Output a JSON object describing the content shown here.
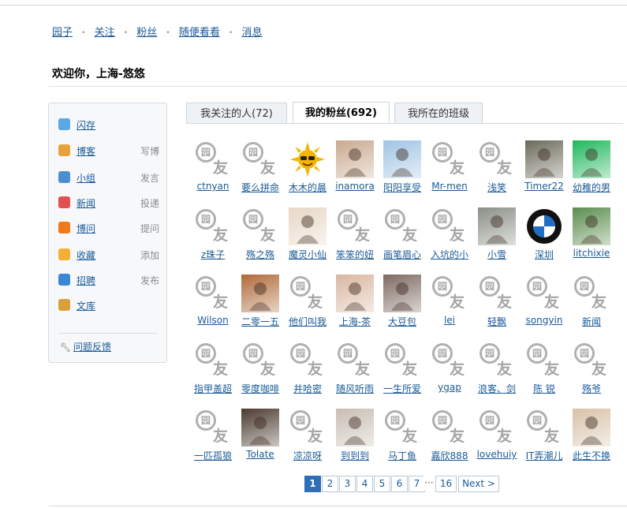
{
  "nav": {
    "items": [
      "园子",
      "关注",
      "粉丝",
      "随便看看",
      "消息"
    ],
    "separator": "•"
  },
  "welcome": "欢迎你，上海-悠悠",
  "sidebar": {
    "items": [
      {
        "label": "闪存",
        "action": "",
        "icon": "speech-bubble-icon",
        "color": "#5aa9e6"
      },
      {
        "label": "博客",
        "action": "写博",
        "icon": "notepad-pencil-icon",
        "color": "#e8a23a"
      },
      {
        "label": "小组",
        "action": "发言",
        "icon": "group-icon",
        "color": "#4a8fd4"
      },
      {
        "label": "新闻",
        "action": "投递",
        "icon": "news-icon",
        "color": "#e05050"
      },
      {
        "label": "博问",
        "action": "提问",
        "icon": "question-icon",
        "color": "#f07a1a"
      },
      {
        "label": "收藏",
        "action": "添加",
        "icon": "folder-icon",
        "color": "#f2b035"
      },
      {
        "label": "招聘",
        "action": "发布",
        "icon": "person-icon",
        "color": "#3b86d6"
      },
      {
        "label": "文库",
        "action": "",
        "icon": "book-icon",
        "color": "#d8a03a"
      }
    ],
    "feedback": "问题反馈",
    "feedback_icon": "wrench-icon"
  },
  "tabs": [
    {
      "label": "我关注的人(72)",
      "active": false
    },
    {
      "label": "我的粉丝(692)",
      "active": true
    },
    {
      "label": "我所在的班级",
      "active": false
    }
  ],
  "default_avatar": {
    "top": "园",
    "bottom": "友"
  },
  "users": [
    {
      "name": "ctnyan",
      "avatar": "default"
    },
    {
      "name": "要么拼命",
      "avatar": "default"
    },
    {
      "name": "木木的晨",
      "avatar": "sun",
      "color": "#f4b400"
    },
    {
      "name": "inamora",
      "avatar": "photo",
      "color": "#c9a98e"
    },
    {
      "name": "阳阳享受",
      "avatar": "photo",
      "color": "#9fc4e3"
    },
    {
      "name": "Mr-men",
      "avatar": "default"
    },
    {
      "name": "浅笑",
      "avatar": "default"
    },
    {
      "name": "Timer22",
      "avatar": "photo",
      "color": "#6a6a5a"
    },
    {
      "name": "幼稚的男",
      "avatar": "photo",
      "color": "#1fb85c"
    },
    {
      "name": "z珠子",
      "avatar": "default"
    },
    {
      "name": "殇之殇",
      "avatar": "default"
    },
    {
      "name": "魔灵小仙",
      "avatar": "photo",
      "color": "#e8d7c5"
    },
    {
      "name": "笨笨的妞",
      "avatar": "default"
    },
    {
      "name": "画笔眉心",
      "avatar": "default"
    },
    {
      "name": "入坑的小",
      "avatar": "default"
    },
    {
      "name": "小雪",
      "avatar": "photo",
      "color": "#8a8f86"
    },
    {
      "name": "深圳",
      "avatar": "bmw",
      "color": "#1f6fc5"
    },
    {
      "name": "litchixie",
      "avatar": "photo",
      "color": "#5a8d4e"
    },
    {
      "name": "Wilson",
      "avatar": "default"
    },
    {
      "name": "二零一五",
      "avatar": "photo",
      "color": "#b06a3a"
    },
    {
      "name": "他们叫我",
      "avatar": "default"
    },
    {
      "name": "上海-茶",
      "avatar": "photo",
      "color": "#d9b7a0"
    },
    {
      "name": "大豆包",
      "avatar": "photo",
      "color": "#7d6a62"
    },
    {
      "name": "lei",
      "avatar": "default"
    },
    {
      "name": "轻飘",
      "avatar": "default"
    },
    {
      "name": "songyin",
      "avatar": "default"
    },
    {
      "name": "新闻",
      "avatar": "default"
    },
    {
      "name": "指甲盖超",
      "avatar": "default"
    },
    {
      "name": "零度咖啡",
      "avatar": "default"
    },
    {
      "name": "井哈密",
      "avatar": "default"
    },
    {
      "name": "随风听雨",
      "avatar": "default"
    },
    {
      "name": "一生所爱",
      "avatar": "default"
    },
    {
      "name": "ygap",
      "avatar": "default"
    },
    {
      "name": "浪客、剑",
      "avatar": "default"
    },
    {
      "name": "陈 锐",
      "avatar": "default"
    },
    {
      "name": "殇爷",
      "avatar": "default"
    },
    {
      "name": "一匹孤狼",
      "avatar": "default"
    },
    {
      "name": "Tolate",
      "avatar": "photo",
      "color": "#4a3a2e"
    },
    {
      "name": "凉凉呀",
      "avatar": "default"
    },
    {
      "name": "到到到",
      "avatar": "photo",
      "color": "#c8bdb3"
    },
    {
      "name": "马丁鱼",
      "avatar": "default"
    },
    {
      "name": "嘉欣888",
      "avatar": "default"
    },
    {
      "name": "lovehuiy",
      "avatar": "default"
    },
    {
      "name": "IT弄潮儿",
      "avatar": "default"
    },
    {
      "name": "此生不换",
      "avatar": "photo",
      "color": "#d8c2a8"
    }
  ],
  "pager": {
    "pages": [
      "1",
      "2",
      "3",
      "4",
      "5",
      "6",
      "7"
    ],
    "dots": "···",
    "last": "16",
    "next": "Next >",
    "current": "1"
  }
}
